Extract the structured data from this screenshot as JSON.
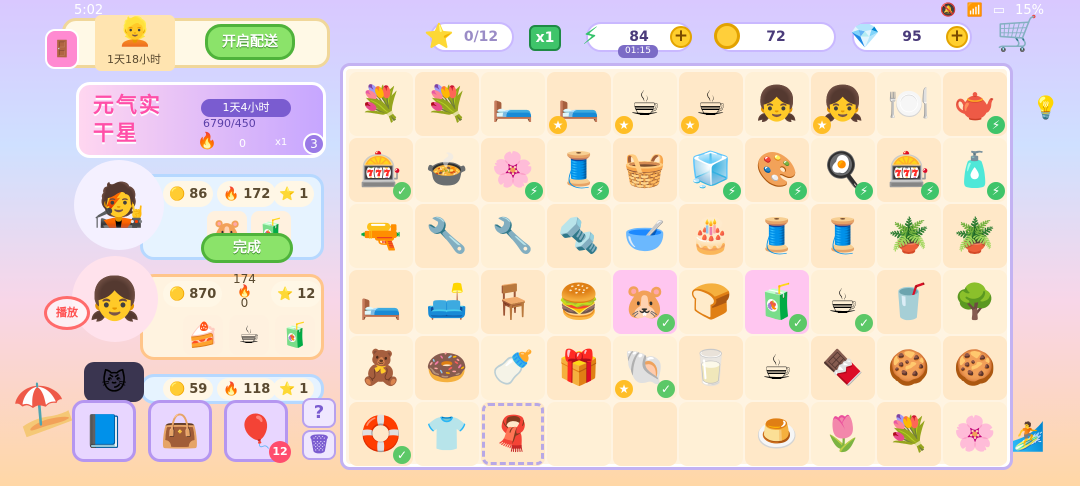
{
  "status_bar": {
    "time": "5:02",
    "battery": "15%"
  },
  "topbar": {
    "star_progress": "0/12",
    "multiplier": "x1",
    "energy": "84",
    "energy_timer": "01:15",
    "coins": "72",
    "gems": "95",
    "plus": "+"
  },
  "delivery": {
    "timer": "1天18小时",
    "button": "开启配送"
  },
  "event": {
    "title": "元气实干星",
    "timer": "1天4小时",
    "progress": "6790/450",
    "current": "0",
    "multiplier": "x1",
    "level": "3"
  },
  "orders": [
    {
      "coins": "86",
      "fire": "172",
      "stars": "1",
      "button": "完成"
    },
    {
      "coins": "870",
      "fire": "174",
      "sub": "0",
      "stars": "12",
      "tag": "播放"
    },
    {
      "coins": "59",
      "fire": "118",
      "stars": "1"
    }
  ],
  "bottom_tools": {
    "gift_count": "12",
    "help": "?"
  },
  "board": {
    "rows": [
      [
        "💐",
        "💐",
        "🛏️",
        "🛏️",
        "☕",
        "☕",
        "👧",
        "👧",
        "🍽️",
        "🫖"
      ],
      [
        "🎰",
        "🍲",
        "🌸",
        "🧵",
        "🧺",
        "🧊",
        "🎨",
        "🍳",
        "🎰",
        "🧴"
      ],
      [
        "🔫",
        "🔧",
        "🔧",
        "🔩",
        "🥣",
        "🎂",
        "🧵",
        "🧵",
        "🪴",
        "🪴"
      ],
      [
        "🛏️",
        "🛋️",
        "🪑",
        "🍔",
        "🐹",
        "🍞",
        "🧃",
        "☕",
        "🥤",
        "🌳"
      ],
      [
        "🧸",
        "🍩",
        "🍼",
        "🎁",
        "🐚",
        "🥛",
        "☕",
        "🍫",
        "🍪",
        "🍪"
      ],
      [
        "🛟",
        "👕",
        "🧣",
        "",
        "",
        "",
        "🍮",
        "🌷",
        "💐",
        "🌸"
      ]
    ],
    "highlighted": [
      "3,4",
      "3,6"
    ],
    "checked": [
      "1,0",
      "3,4",
      "3,6",
      "3,7",
      "4,4",
      "5,0"
    ],
    "bolts": [
      "0,9",
      "1,0",
      "1,2",
      "1,3",
      "1,5",
      "1,6",
      "1,7",
      "1,8",
      "1,9"
    ],
    "starred": [
      "0,3",
      "0,4",
      "0,5",
      "0,7",
      "4,4"
    ]
  }
}
